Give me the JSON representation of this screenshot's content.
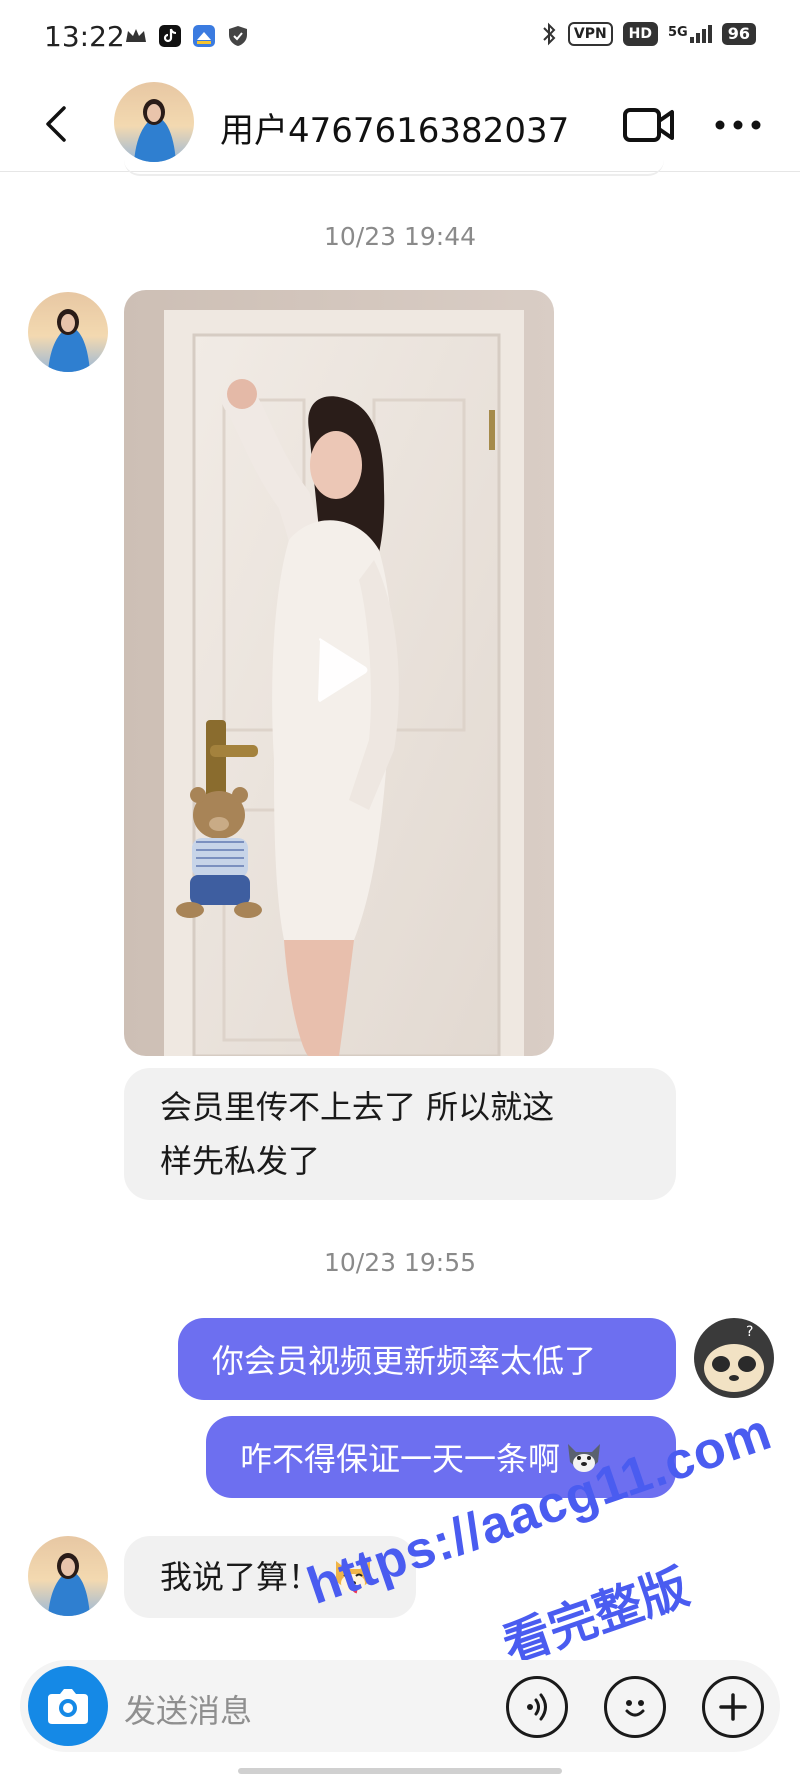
{
  "status_bar": {
    "time": "13:22",
    "left_icons": [
      "crown-icon",
      "tiktok-icon",
      "app-icon",
      "shield-icon"
    ],
    "right_icons": [
      "bluetooth-icon",
      "vpn-badge",
      "hd-badge",
      "signal-5g-icon",
      "battery-icon"
    ],
    "vpn": "VPN",
    "hd": "HD",
    "network": "5G",
    "battery": "96"
  },
  "header": {
    "title": "用户4767616382037",
    "back_icon": "chevron-left-icon",
    "video_call_icon": "video-camera-icon",
    "more_icon": "more-dots-icon"
  },
  "messages": {
    "timestamp_1": "10/23 19:44",
    "incoming_text_1_line1": "会员里传不上去了  所以就这",
    "incoming_text_1_line2": "样先私发了",
    "timestamp_2": "10/23 19:55",
    "outgoing_1": "你会员视频更新频率太低了",
    "outgoing_2": "咋不得保证一天一条啊",
    "incoming_text_2": "我说了算！"
  },
  "watermark": {
    "url": "https://aacg11.com",
    "subtitle": "看完整版"
  },
  "input_bar": {
    "placeholder": "发送消息",
    "camera_icon": "camera-icon",
    "voice_icon": "voice-icon",
    "emoji_icon": "emoji-icon",
    "plus_icon": "plus-icon"
  },
  "colors": {
    "outgoing_bubble": "#6d6ff0",
    "incoming_bubble": "#f1f1f1",
    "camera_button": "#1589e6",
    "watermark": "#4a5cf0"
  }
}
